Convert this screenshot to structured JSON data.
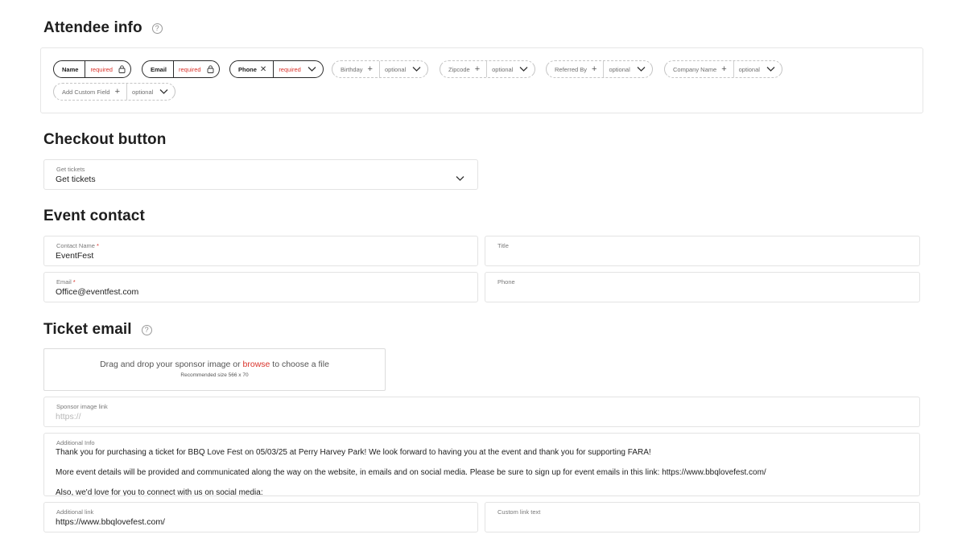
{
  "attendee": {
    "title": "Attendee info",
    "help": "?",
    "chips": [
      {
        "name": "Name",
        "status": "required",
        "icon": "lock-icon",
        "kind": "required"
      },
      {
        "name": "Email",
        "status": "required",
        "icon": "lock-icon",
        "kind": "required"
      },
      {
        "name": "Phone",
        "status": "required",
        "icon": "close-icon",
        "kind": "required"
      },
      {
        "name": "Birthday",
        "status": "optional",
        "icon": "plus-icon",
        "kind": "optional"
      },
      {
        "name": "Zipcode",
        "status": "optional",
        "icon": "plus-icon",
        "kind": "optional"
      },
      {
        "name": "Referred By",
        "status": "optional",
        "icon": "plus-icon",
        "kind": "optional"
      },
      {
        "name": "Company Name",
        "status": "optional",
        "icon": "plus-icon",
        "kind": "optional"
      },
      {
        "name": "Add Custom Field",
        "status": "optional",
        "icon": "plus-icon",
        "kind": "optional"
      }
    ]
  },
  "checkout": {
    "title": "Checkout button",
    "label": "Get tickets",
    "value": "Get tickets"
  },
  "contact": {
    "title": "Event contact",
    "name_label": "Contact Name",
    "name_value": "EventFest",
    "title_label": "Title",
    "title_value": "",
    "email_label": "Email",
    "email_value": "Office@eventfest.com",
    "phone_label": "Phone",
    "phone_value": "",
    "required_mark": "*"
  },
  "ticket_email": {
    "title": "Ticket email",
    "help": "?",
    "drop_text_before": "Drag and drop your sponsor image or ",
    "drop_browse": "browse",
    "drop_text_after": " to choose a file",
    "drop_recommended": "Recommended size 566 x 70",
    "sponsor_label": "Sponsor image link",
    "sponsor_placeholder": "https://",
    "additional_info_label": "Additional Info",
    "additional_info_lines": [
      "Thank you for purchasing a ticket for BBQ Love Fest on 05/03/25 at Perry Harvey Park! We look forward to having you at the event and thank you for supporting FARA!",
      "More event details will be provided and communicated along the way on the website, in emails and on social media. Please be sure to sign up for event emails in this link: https://www.bbqlovefest.com/",
      "Also, we'd love for you to connect with us on social media:"
    ],
    "additional_link_label": "Additional link",
    "additional_link_value": "https://www.bbqlovefest.com/",
    "custom_link_label": "Custom link text",
    "custom_link_value": ""
  },
  "colors": {
    "accent": "#d9322a",
    "border": "#e3e3e3",
    "text": "#1e1e1e"
  }
}
